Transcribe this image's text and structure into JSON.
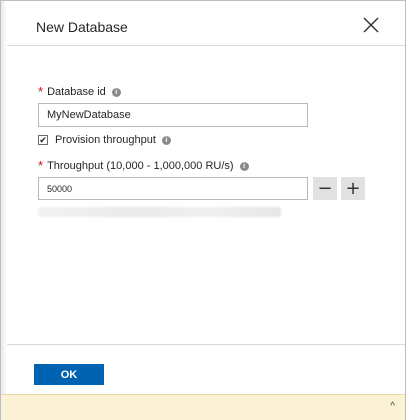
{
  "dialog": {
    "title": "New Database",
    "database_id": {
      "required_mark": "*",
      "label": "Database id",
      "value": "MyNewDatabase"
    },
    "provision": {
      "checked": true,
      "check_glyph": "✔",
      "label": "Provision throughput"
    },
    "throughput": {
      "required_mark": "*",
      "label": "Throughput (10,000 - 1,000,000 RU/s)",
      "value": "50000",
      "decrement_glyph": "−",
      "increment_glyph": "+"
    },
    "info_glyph": "i",
    "ok_label": "OK",
    "scroll_glyph": "^"
  },
  "colors": {
    "primary_button": "#0063b1",
    "required": "#c50f1f",
    "bottom_bar": "#fbf1d5"
  },
  "icons": [
    "close-icon",
    "info-icon",
    "checkbox-check-icon",
    "minus-icon",
    "plus-icon",
    "chevron-up-icon"
  ]
}
